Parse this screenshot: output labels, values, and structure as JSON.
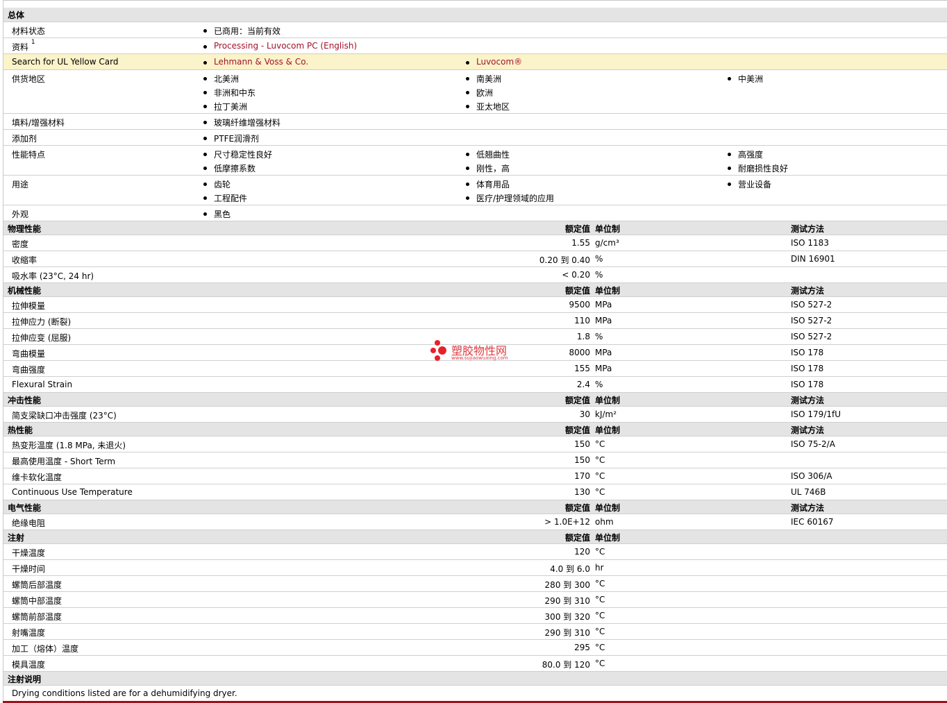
{
  "general": {
    "title": "总体",
    "rows": [
      {
        "label": "材料状态",
        "items": [
          [
            "已商用：当前有效"
          ]
        ]
      },
      {
        "label": "资料",
        "sup": "1",
        "items": [
          [
            "Processing - Luvocom PC (English)"
          ]
        ]
      },
      {
        "label": "Search for UL Yellow Card",
        "items": [
          [
            "Lehmann & Voss & Co."
          ],
          [
            "Luvocom®"
          ]
        ]
      },
      {
        "label": "供货地区",
        "items": [
          [
            "北美洲",
            "非洲和中东",
            "拉丁美洲"
          ],
          [
            "南美洲",
            "欧洲",
            "亚太地区"
          ],
          [
            "中美洲"
          ]
        ]
      },
      {
        "label": "填料/增强材料",
        "items": [
          [
            "玻璃纤维增强材料"
          ]
        ]
      },
      {
        "label": "添加剂",
        "items": [
          [
            "PTFE润滑剂"
          ]
        ]
      },
      {
        "label": "性能特点",
        "items": [
          [
            "尺寸稳定性良好",
            "低摩擦系数"
          ],
          [
            "低翘曲性",
            "刚性，高"
          ],
          [
            "高强度",
            "耐磨损性良好"
          ]
        ]
      },
      {
        "label": "用途",
        "items": [
          [
            "齿轮",
            "工程配件"
          ],
          [
            "体育用品",
            "医疗/护理领域的应用"
          ],
          [
            "营业设备"
          ]
        ]
      },
      {
        "label": "外观",
        "items": [
          [
            "黑色"
          ]
        ]
      }
    ]
  },
  "headers": {
    "nominal": "额定值",
    "unit": "单位制",
    "test": "测试方法"
  },
  "physical": {
    "title": "物理性能",
    "rows": [
      {
        "label": "密度",
        "value": "1.55",
        "unit": "g/cm³",
        "test": "ISO 1183"
      },
      {
        "label": "收缩率",
        "value": "0.20 到  0.40",
        "unit": "%",
        "test": "DIN 16901"
      },
      {
        "label": "吸水率  (23°C, 24 hr)",
        "value": "< 0.20",
        "unit": "%",
        "test": ""
      }
    ]
  },
  "mechanical": {
    "title": "机械性能",
    "rows": [
      {
        "label": "拉伸模量",
        "value": "9500",
        "unit": "MPa",
        "test": "ISO 527-2"
      },
      {
        "label": "拉伸应力  (断裂)",
        "value": "110",
        "unit": "MPa",
        "test": "ISO 527-2"
      },
      {
        "label": "拉伸应变  (屈服)",
        "value": "1.8",
        "unit": "%",
        "test": "ISO 527-2"
      },
      {
        "label": "弯曲模量",
        "value": "8000",
        "unit": "MPa",
        "test": "ISO 178"
      },
      {
        "label": "弯曲强度",
        "value": "155",
        "unit": "MPa",
        "test": "ISO 178"
      },
      {
        "label": "Flexural Strain",
        "value": "2.4",
        "unit": "%",
        "test": "ISO 178"
      }
    ]
  },
  "impact": {
    "title": "冲击性能",
    "rows": [
      {
        "label": "简支梁缺口冲击强度  (23°C)",
        "value": "30",
        "unit": "kJ/m²",
        "test": "ISO 179/1fU"
      }
    ]
  },
  "thermal": {
    "title": "热性能",
    "rows": [
      {
        "label": "热变形温度  (1.8 MPa, 未退火)",
        "value": "150",
        "unit": "°C",
        "test": "ISO 75-2/A"
      },
      {
        "label": "最高使用温度  - Short Term",
        "value": "150",
        "unit": "°C",
        "test": ""
      },
      {
        "label": "维卡软化温度",
        "value": "170",
        "unit": "°C",
        "test": "ISO 306/A"
      },
      {
        "label": "Continuous Use Temperature",
        "value": "130",
        "unit": "°C",
        "test": "UL 746B"
      }
    ]
  },
  "electrical": {
    "title": "电气性能",
    "rows": [
      {
        "label": "绝缘电阻",
        "value": "> 1.0E+12",
        "unit": "ohm",
        "test": "IEC 60167"
      }
    ]
  },
  "injection": {
    "title": "注射",
    "rows": [
      {
        "label": "干燥温度",
        "value": "120",
        "unit": "°C"
      },
      {
        "label": "干燥时间",
        "value": "4.0 到  6.0",
        "unit": "hr"
      },
      {
        "label": "螺筒后部温度",
        "value": "280 到  300",
        "unit": "°C"
      },
      {
        "label": "螺筒中部温度",
        "value": "290 到  310",
        "unit": "°C"
      },
      {
        "label": "螺筒前部温度",
        "value": "300 到  320",
        "unit": "°C"
      },
      {
        "label": "射嘴温度",
        "value": "290 到  310",
        "unit": "°C"
      },
      {
        "label": "加工（熔体）温度",
        "value": "295",
        "unit": "°C"
      },
      {
        "label": "模具温度",
        "value": "80.0 到  120",
        "unit": "°C"
      }
    ]
  },
  "injection_notes": {
    "title": "注射说明",
    "text": "Drying conditions listed are for a dehumidifying dryer."
  },
  "watermark": {
    "text": "塑胶物性网",
    "url": "www.sujiaowuxing.com",
    "color": "#e8202a"
  },
  "colors": {
    "link": "#a3112c",
    "section_bg": "#e4e4e4",
    "highlight_bg": "#fbf3c9"
  }
}
